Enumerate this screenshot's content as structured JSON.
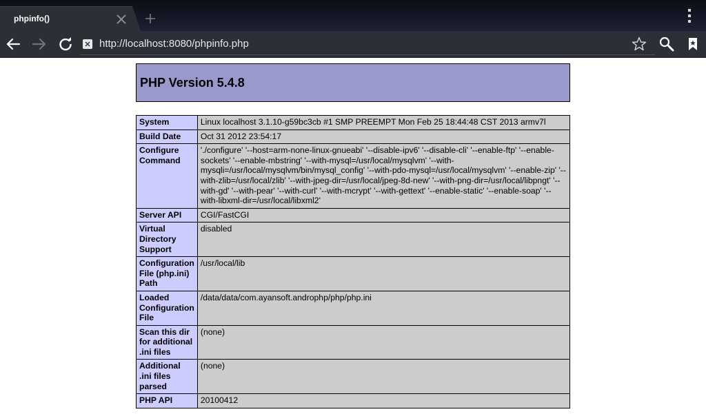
{
  "browser": {
    "tab_title": "phpinfo()",
    "url": "http://localhost:8080/phpinfo.php"
  },
  "page": {
    "header_title": "PHP Version 5.4.8",
    "rows": [
      {
        "label": "System",
        "value": "Linux localhost 3.1.10-g59bc3cb #1 SMP PREEMPT Mon Feb 25 18:44:48 CST 2013 armv7l"
      },
      {
        "label": "Build Date",
        "value": "Oct 31 2012 23:54:17"
      },
      {
        "label": "Configure Command",
        "value": "'./configure' '--host=arm-none-linux-gnueabi' '--disable-ipv6' '--disable-cli' '--enable-ftp' '--enable-sockets' '--enable-mbstring' '--with-mysql=/usr/local/mysqlvm' '--with-mysqli=/usr/local/mysqlvm/bin/mysql_config' '--with-pdo-mysql=/usr/local/mysqlvm' '--enable-zip' '--with-zlib=/usr/local/zlib' '--with-jpeg-dir=/usr/local/jpeg-8d-new' '--with-png-dir=/usr/local/libpngt' '--with-gd' '--with-pear' '--with-curl' '--with-mcrypt' '--with-gettext' '--enable-static' '--enable-soap' '--with-libxml-dir=/usr/local/libxml2'"
      },
      {
        "label": "Server API",
        "value": "CGI/FastCGI"
      },
      {
        "label": "Virtual Directory Support",
        "value": "disabled"
      },
      {
        "label": "Configuration File (php.ini) Path",
        "value": "/usr/local/lib"
      },
      {
        "label": "Loaded Configuration File",
        "value": "/data/data/com.ayansoft.androphp/php/php.ini"
      },
      {
        "label": "Scan this dir for additional .ini files",
        "value": "(none)"
      },
      {
        "label": "Additional .ini files parsed",
        "value": "(none)"
      },
      {
        "label": "PHP API",
        "value": "20100412"
      }
    ]
  },
  "icons": {
    "tab_close": "close-icon",
    "new_tab": "plus-icon",
    "menu": "overflow-menu-icon",
    "back": "back-arrow-icon",
    "forward": "forward-arrow-icon",
    "reload": "reload-icon",
    "favicon": "site-favicon-icon",
    "bookmark_star": "star-icon",
    "search": "search-icon",
    "bookmarks": "bookmarks-icon"
  },
  "colors": {
    "header_bg": "#9999cc",
    "label_cell_bg": "#ccccff",
    "value_cell_bg": "#cccccc",
    "chrome_bg": "#2c2f36"
  }
}
